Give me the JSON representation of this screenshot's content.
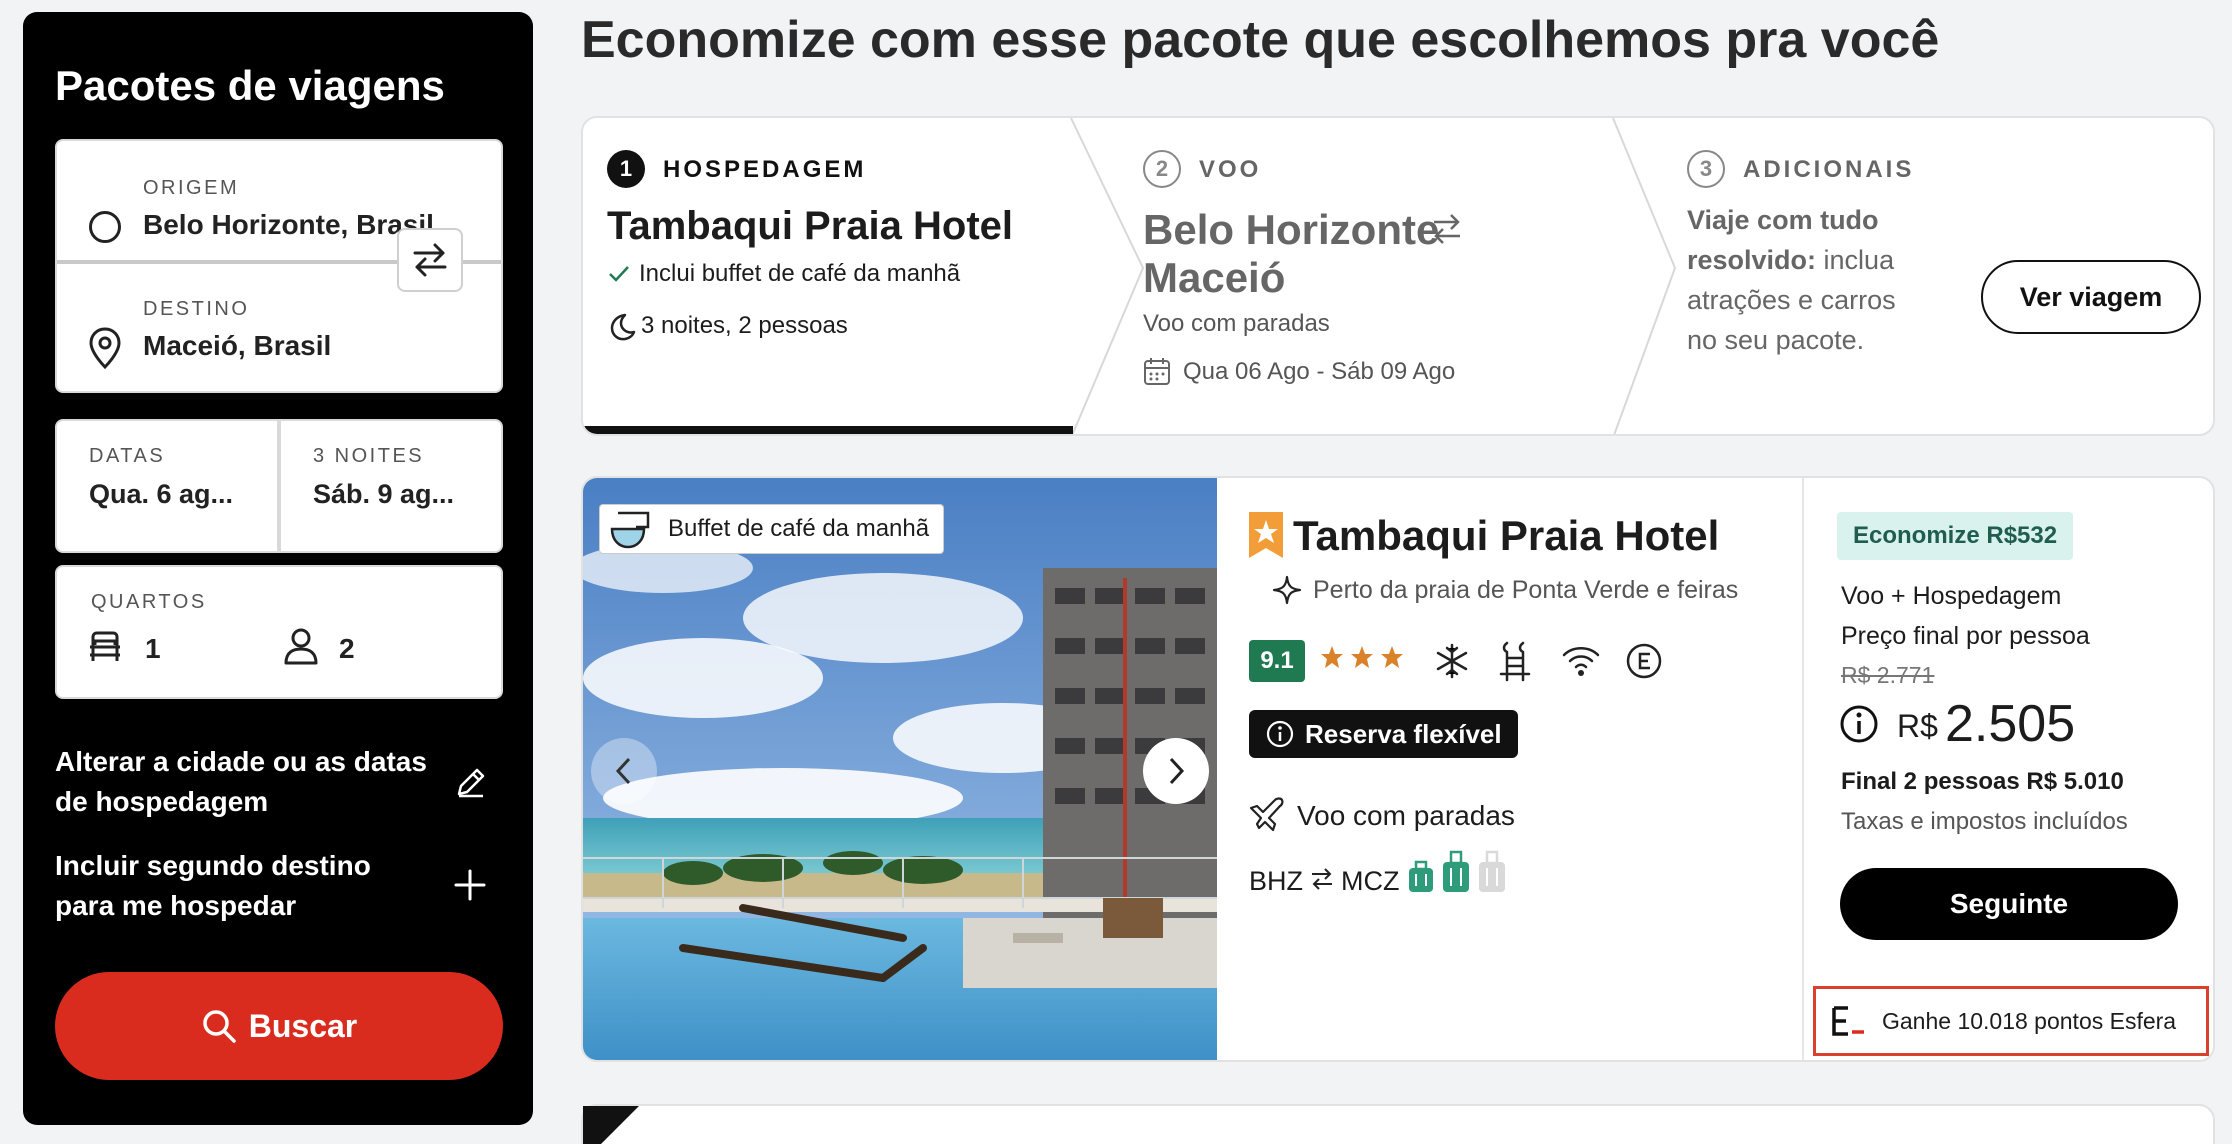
{
  "sidebar": {
    "title": "Pacotes de viagens",
    "origin_label": "ORIGEM",
    "origin_value": "Belo Horizonte, Brasil",
    "dest_label": "DESTINO",
    "dest_value": "Maceió, Brasil",
    "dates_label": "DATAS",
    "dates_value": "Qua. 6 ag...",
    "nights_label": "3 NOITES",
    "nights_value": "Sáb. 9 ag...",
    "rooms_label": "QUARTOS",
    "rooms_count": "1",
    "people_count": "2",
    "link_change": "Alterar a cidade ou as datas de hospedagem",
    "link_second": "Incluir segundo destino para me hospedar",
    "search_label": "Buscar"
  },
  "main": {
    "title": "Economize com esse pacote que escolhemos pra você"
  },
  "steps": [
    {
      "num": "1",
      "label": "HOSPEDAGEM",
      "title": "Tambaqui Praia Hotel",
      "line1": "Inclui buffet de café da manhã",
      "line2": "3 noites, 2 pessoas"
    },
    {
      "num": "2",
      "label": "VOO",
      "title_a": "Belo Horizonte",
      "title_b": "Maceió",
      "line1": "Voo com paradas",
      "line2": "Qua 06 Ago - Sáb 09 Ago"
    },
    {
      "num": "3",
      "label": "ADICIONAIS",
      "bold": "Viaje com tudo resolvido:",
      "text": "inclua atrações e carros no seu pacote.",
      "button": "Ver viagem"
    }
  ],
  "result": {
    "photo_badge": "Buffet de café da manhã",
    "hotel_name": "Tambaqui Praia Hotel",
    "hotel_sub": "Perto da praia de Ponta Verde e feiras",
    "rating": "9.1",
    "stars": 3,
    "flex_label": "Reserva flexível",
    "flight_label": "Voo com paradas",
    "from_code": "BHZ",
    "to_code": "MCZ",
    "save_badge": "Economize R$532",
    "pkg_type": "Voo + Hospedagem",
    "price_caption": "Preço final por pessoa",
    "old_price": "R$ 2.771",
    "currency": "R$",
    "price": "2.505",
    "final_total": "Final 2 pessoas R$ 5.010",
    "taxes": "Taxas e impostos incluídos",
    "next_button": "Seguinte",
    "points": "Ganhe 10.018 pontos Esfera"
  },
  "colors": {
    "accent_red": "#d92c1f",
    "rating_green": "#1f7a52",
    "save_bg": "#d9f2ee",
    "star_orange": "#d9822b"
  },
  "icons": [
    "circle-icon",
    "pin-icon",
    "swap-icon",
    "bed-icon",
    "person-icon",
    "pencil-icon",
    "plus-icon",
    "search-icon",
    "check-icon",
    "moon-icon",
    "swap-arrows-icon",
    "calendar-icon",
    "coffee-icon",
    "chevron-left-icon",
    "chevron-right-icon",
    "hotel-star-icon",
    "sparkle-icon",
    "star-icon",
    "snowflake-icon",
    "pool-chair-icon",
    "wifi-icon",
    "euro-icon",
    "info-icon",
    "plane-icon",
    "luggage-icon",
    "esfera-logo-icon"
  ]
}
